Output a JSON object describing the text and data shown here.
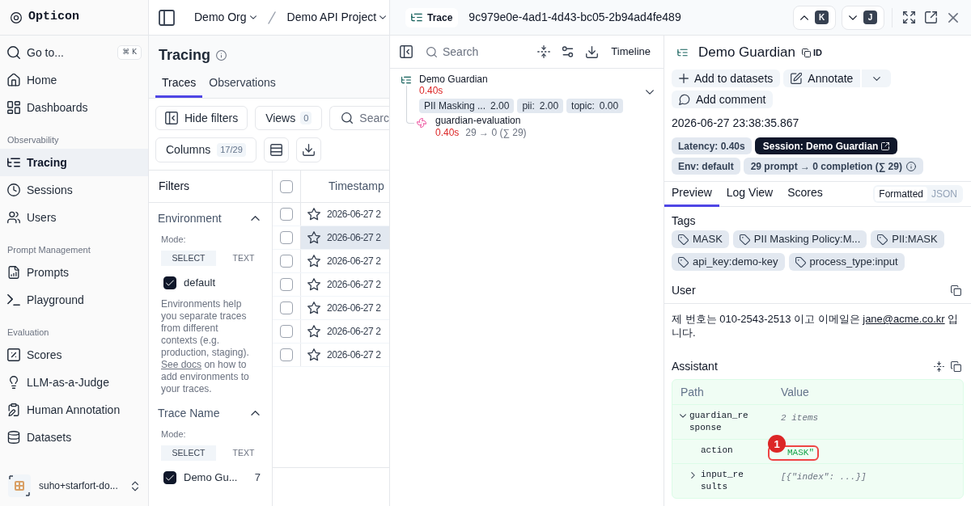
{
  "sidebar": {
    "brand": "Opticon",
    "goto": {
      "label": "Go to...",
      "shortcut": "⌘ K"
    },
    "groups": [
      {
        "items": [
          {
            "label": "Home",
            "selected": false
          },
          {
            "label": "Dashboards",
            "selected": false
          }
        ]
      },
      {
        "title": "Observability",
        "items": [
          {
            "label": "Tracing",
            "selected": true
          },
          {
            "label": "Sessions",
            "selected": false
          },
          {
            "label": "Users",
            "selected": false
          }
        ]
      },
      {
        "title": "Prompt Management",
        "items": [
          {
            "label": "Prompts",
            "selected": false
          },
          {
            "label": "Playground",
            "selected": false
          }
        ]
      },
      {
        "title": "Evaluation",
        "items": [
          {
            "label": "Scores",
            "selected": false
          },
          {
            "label": "LLM-as-a-Judge",
            "selected": false
          },
          {
            "label": "Human Annotation",
            "selected": false
          },
          {
            "label": "Datasets",
            "selected": false
          }
        ]
      }
    ],
    "account": {
      "name": "suho+starfort-do..."
    }
  },
  "breadcrumbs": [
    {
      "label": "Demo Org"
    },
    {
      "label": "Demo API Project"
    }
  ],
  "page": {
    "title": "Tracing",
    "tabs": [
      {
        "label": "Traces",
        "selected": true
      },
      {
        "label": "Observations",
        "selected": false
      }
    ],
    "toolbar": {
      "hide_filters": "Hide filters",
      "views": {
        "label": "Views",
        "count": "0"
      },
      "search": {
        "placeholder": "Searc"
      },
      "columns": {
        "label": "Columns",
        "count": "17/29"
      }
    }
  },
  "filters": {
    "title": "Filters",
    "sections": [
      {
        "title": "Environment",
        "expanded": true,
        "mode_label": "Mode:",
        "modes": [
          {
            "label": "SELECT",
            "selected": true
          },
          {
            "label": "TEXT",
            "selected": false
          }
        ],
        "options": [
          {
            "label": "default",
            "checked": true
          }
        ],
        "help": {
          "before": "Environments help you separate traces from different contexts (e.g. production, staging).",
          "link": "See docs",
          "after": "on how to add environments to your traces."
        }
      },
      {
        "title": "Trace Name",
        "expanded": true,
        "mode_label": "Mode:",
        "modes": [
          {
            "label": "SELECT",
            "selected": true
          },
          {
            "label": "TEXT",
            "selected": false
          }
        ],
        "options": [
          {
            "label": "Demo Gu...",
            "count": "7",
            "checked": true
          }
        ]
      }
    ]
  },
  "table": {
    "columns": [
      {
        "label": "Timestamp"
      }
    ],
    "all_checked": false,
    "rows": [
      {
        "timestamp": "2026-06-27 2",
        "checked": false,
        "selected": false
      },
      {
        "timestamp": "2026-06-27 2",
        "checked": false,
        "selected": true
      },
      {
        "timestamp": "2026-06-27 2",
        "checked": false,
        "selected": false
      },
      {
        "timestamp": "2026-06-27 2",
        "checked": false,
        "selected": false
      },
      {
        "timestamp": "2026-06-27 2",
        "checked": false,
        "selected": false
      },
      {
        "timestamp": "2026-06-27 2",
        "checked": false,
        "selected": false
      },
      {
        "timestamp": "2026-06-27 2",
        "checked": false,
        "selected": false
      }
    ]
  },
  "trace": {
    "badge": "Trace",
    "id": "9c979e0e-4ad1-4d43-bc05-2b94ad4fe489",
    "nav": [
      {
        "key": "K"
      },
      {
        "key": "J"
      }
    ],
    "tree": {
      "search": {
        "placeholder": "Search"
      },
      "timeline": "Timeline",
      "nodes": [
        {
          "kind": "trace",
          "name": "Demo Guardian",
          "latency": "0.40s",
          "expanded": true,
          "scores": [
            {
              "name": "PII Masking ...",
              "value": "2.00"
            },
            {
              "name": "pii:",
              "value": "2.00"
            },
            {
              "name": "topic:",
              "value": "0.00"
            }
          ],
          "children": [
            {
              "kind": "generation",
              "name": "guardian-evaluation",
              "latency": "0.40s",
              "usage": "29 → 0 (∑ 29)"
            }
          ]
        }
      ]
    },
    "detail": {
      "title": "Demo Guardian",
      "id_label": "ID",
      "actions": [
        {
          "kind": "add",
          "label": "Add to datasets"
        },
        {
          "kind": "annotate",
          "label": "Annotate"
        },
        {
          "kind": "comment",
          "label": "Add comment"
        }
      ],
      "timestamp": "2026-06-27 23:38:35.867",
      "badges": [
        {
          "kind": "plain",
          "label": "Latency: 0.40s"
        },
        {
          "kind": "session",
          "label": "Session: Demo Guardian"
        },
        {
          "kind": "plain",
          "label": "Env: default"
        },
        {
          "kind": "usage",
          "label": "29 prompt → 0 completion (∑ 29)"
        }
      ],
      "tabs": [
        {
          "label": "Preview",
          "selected": true
        },
        {
          "label": "Log View",
          "selected": false
        },
        {
          "label": "Scores",
          "selected": false
        }
      ],
      "view_modes": [
        {
          "label": "Formatted",
          "selected": true
        },
        {
          "label": "JSON",
          "selected": false
        }
      ],
      "tags": {
        "title": "Tags",
        "items": [
          "MASK",
          "PII Masking Policy:M...",
          "PII:MASK",
          "api_key:demo-key",
          "process_type:input"
        ]
      },
      "user": {
        "title": "User",
        "before": "제 번호는 010-2543-2513 이고 이메일은",
        "link": "jane@acme.co.kr",
        "after": "입니다."
      },
      "assistant": {
        "title": "Assistant",
        "columns": [
          "Path",
          "Value"
        ],
        "rows": [
          {
            "kind": "object",
            "path": "guardian_response",
            "value": "2 items",
            "expanded": true,
            "children": [
              {
                "kind": "string",
                "path": "action",
                "value": "MASK\"",
                "callout": "1"
              },
              {
                "kind": "array",
                "path": "input_results",
                "value": "[{\"index\": ...}]",
                "expanded": false
              }
            ]
          }
        ]
      }
    }
  }
}
